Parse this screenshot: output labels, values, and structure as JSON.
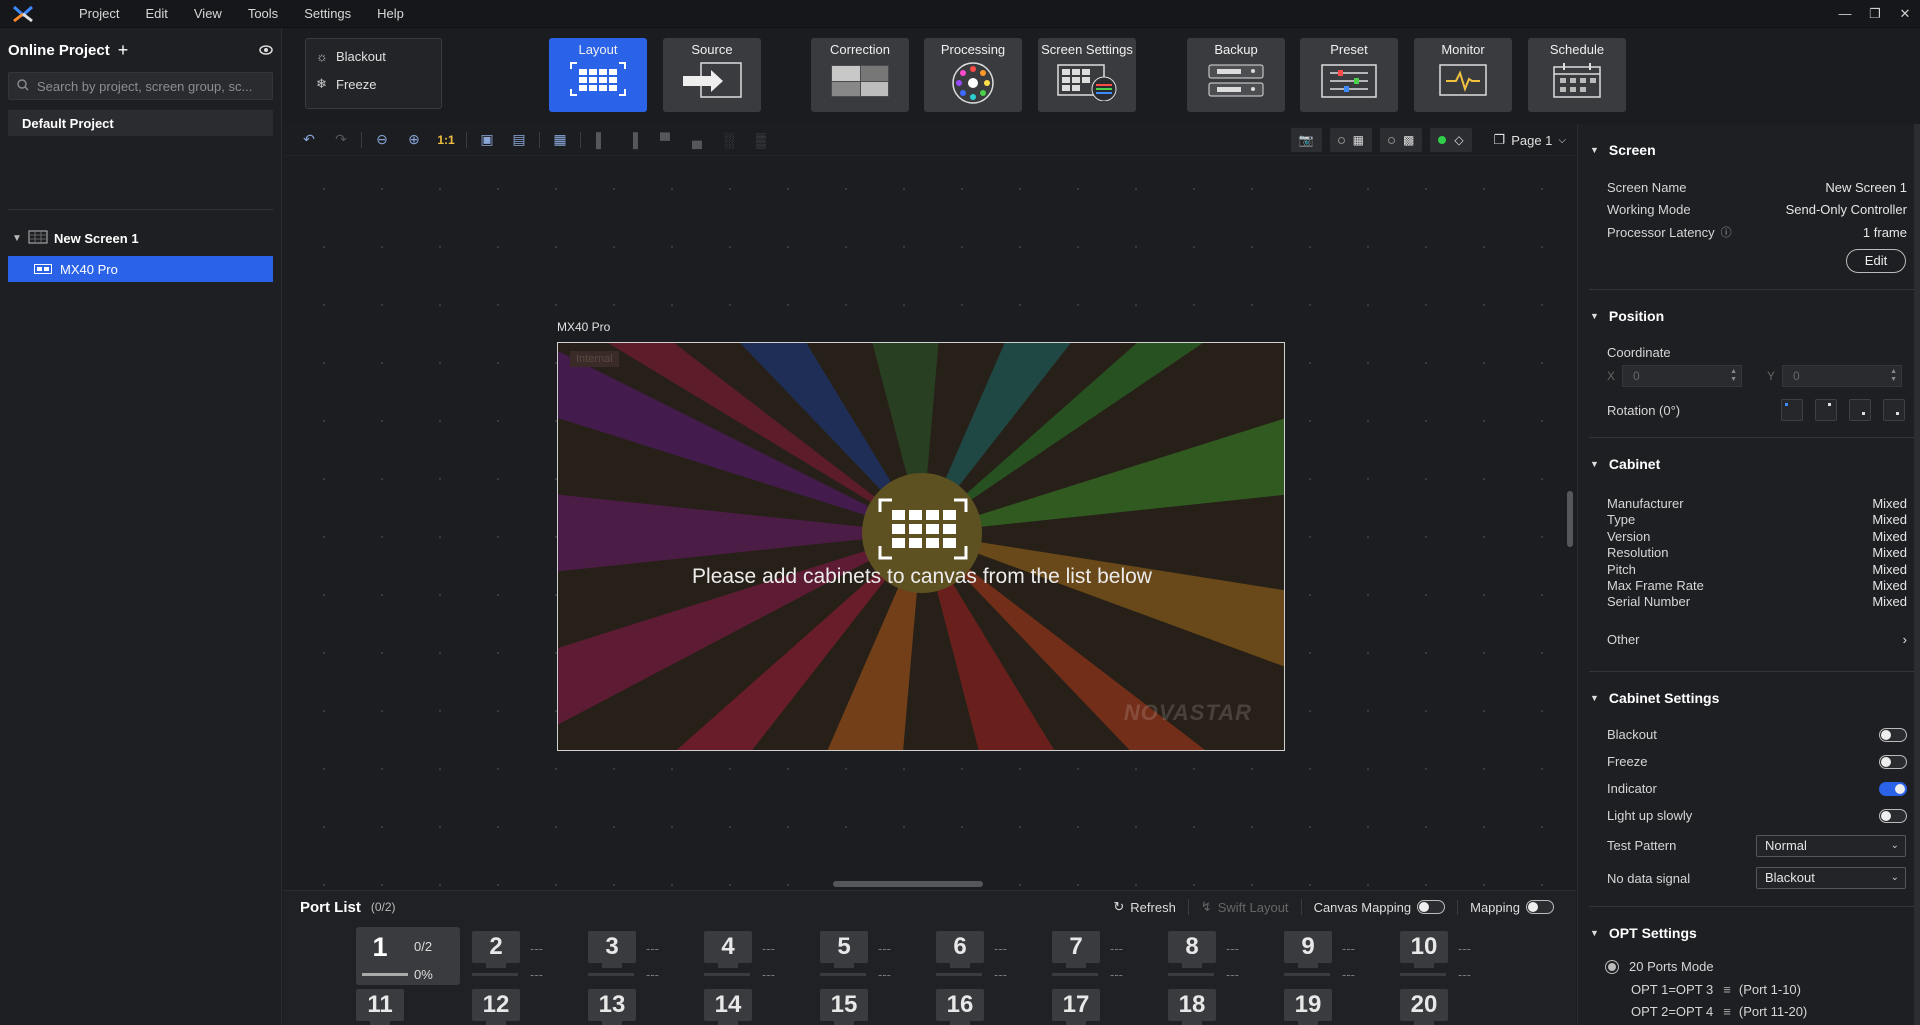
{
  "menu": [
    "Project",
    "Edit",
    "View",
    "Tools",
    "Settings",
    "Help"
  ],
  "sidebar": {
    "title": "Online Project",
    "search_placeholder": "Search by project, screen group, sc...",
    "project": "Default Project",
    "screen": "New Screen 1",
    "device": "MX40 Pro"
  },
  "blackout_freeze": {
    "blackout": "Blackout",
    "freeze": "Freeze"
  },
  "toolbar": {
    "layout": "Layout",
    "source": "Source",
    "correction": "Correction",
    "processing": "Processing",
    "screen_settings": "Screen Settings",
    "backup": "Backup",
    "preset": "Preset",
    "monitor": "Monitor",
    "schedule": "Schedule"
  },
  "canvas": {
    "zoom_1to1": "1:1",
    "page": "Page 1",
    "device_label": "MX40 Pro",
    "internal": "Internal",
    "message": "Please add cabinets to canvas from the list below",
    "watermark": "NOVASTAR"
  },
  "portlist": {
    "title": "Port List",
    "count": "(0/2)",
    "refresh": "Refresh",
    "swift_layout": "Swift Layout",
    "canvas_mapping": "Canvas Mapping",
    "mapping": "Mapping",
    "selected_ratio": "0/2",
    "selected_percent": "0%",
    "empty": "---",
    "row1": [
      "1",
      "2",
      "3",
      "4",
      "5",
      "6",
      "7",
      "8",
      "9",
      "10"
    ],
    "row2": [
      "11",
      "12",
      "13",
      "14",
      "15",
      "16",
      "17",
      "18",
      "19",
      "20"
    ]
  },
  "panel": {
    "screen": {
      "title": "Screen",
      "name_label": "Screen Name",
      "name": "New Screen 1",
      "mode_label": "Working Mode",
      "mode": "Send-Only Controller",
      "latency_label": "Processor Latency",
      "latency": "1 frame",
      "edit": "Edit"
    },
    "position": {
      "title": "Position",
      "coordinate": "Coordinate",
      "x_label": "X",
      "x": "0",
      "y_label": "Y",
      "y": "0",
      "rotation": "Rotation (0°)"
    },
    "cabinet": {
      "title": "Cabinet",
      "rows": [
        {
          "label": "Manufacturer",
          "value": "Mixed"
        },
        {
          "label": "Type",
          "value": "Mixed"
        },
        {
          "label": "Version",
          "value": "Mixed"
        },
        {
          "label": "Resolution",
          "value": "Mixed"
        },
        {
          "label": "Pitch",
          "value": "Mixed"
        },
        {
          "label": "Max Frame Rate",
          "value": "Mixed"
        },
        {
          "label": "Serial Number",
          "value": "Mixed"
        }
      ],
      "other": "Other"
    },
    "cabinet_settings": {
      "title": "Cabinet Settings",
      "blackout": "Blackout",
      "freeze": "Freeze",
      "indicator": "Indicator",
      "light_up": "Light up slowly",
      "test_pattern_label": "Test Pattern",
      "test_pattern": "Normal",
      "no_signal_label": "No data signal",
      "no_signal": "Blackout"
    },
    "opt": {
      "title": "OPT Settings",
      "mode": "20 Ports Mode",
      "opt1": "OPT 1=OPT 3",
      "opt1_ports": "(Port 1-10)",
      "opt2": "OPT 2=OPT 4",
      "opt2_ports": "(Port 11-20)"
    }
  },
  "colors": {
    "accent": "#2a62e8",
    "indicator_on": "#2a62e8",
    "status_green": "#2fd14a"
  }
}
